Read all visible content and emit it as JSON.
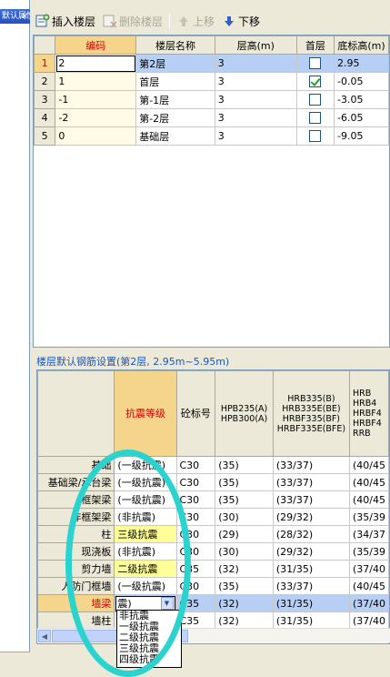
{
  "left_panel": {
    "title": "默认属性",
    "close": "×"
  },
  "toolbar": {
    "insert": "插入楼层",
    "delete": "删除楼层",
    "up": "上移",
    "down": "下移"
  },
  "floor_table": {
    "headers": [
      "编码",
      "楼层名称",
      "层高(m)",
      "首层",
      "底标高(m)"
    ],
    "rows": [
      {
        "n": "1",
        "code": "2",
        "name": "第2层",
        "height": "3",
        "first": false,
        "elev": "2.95"
      },
      {
        "n": "2",
        "code": "1",
        "name": "首层",
        "height": "3",
        "first": true,
        "elev": "-0.05"
      },
      {
        "n": "3",
        "code": "-1",
        "name": "第-1层",
        "height": "3",
        "first": false,
        "elev": "-3.05"
      },
      {
        "n": "4",
        "code": "-2",
        "name": "第-2层",
        "height": "3",
        "first": false,
        "elev": "-6.05"
      },
      {
        "n": "5",
        "code": "0",
        "name": "基础层",
        "height": "3",
        "first": false,
        "elev": "-9.05"
      }
    ]
  },
  "rebar_section": {
    "title": "楼层默认钢筋设置(第2层, 2.95m~5.95m)",
    "headers": {
      "seismic": "抗震等级",
      "concrete": "砼标号",
      "hpb": [
        "HPB235(A)",
        "HPB300(A)"
      ],
      "hrb": [
        "HRB335(B)",
        "HRB335E(BE)",
        "HRBF335(BF)",
        "HRBF335E(BFE)"
      ],
      "hrb4": [
        "HRB",
        "HRB4",
        "HRBF4",
        "HRBF4",
        "RRB"
      ]
    },
    "rows": [
      {
        "name": "基础",
        "seis": "(一级抗震)",
        "conc": "C30",
        "hpb": "(35)",
        "hrb": "(33/37)",
        "r3": "(40/45"
      },
      {
        "name": "基础梁/承台梁",
        "seis": "(一级抗震)",
        "conc": "C30",
        "hpb": "(35)",
        "hrb": "(33/37)",
        "r3": "(40/45"
      },
      {
        "name": "框架梁",
        "seis": "(一级抗震)",
        "conc": "C30",
        "hpb": "(35)",
        "hrb": "(33/37)",
        "r3": "(40/45"
      },
      {
        "name": "非框架梁",
        "seis": "(非抗震)",
        "conc": "C30",
        "hpb": "(30)",
        "hrb": "(29/32)",
        "r3": "(35/39"
      },
      {
        "name": "柱",
        "seis": "三级抗震",
        "conc": "C30",
        "hpb": "(29)",
        "hrb": "(28/32)",
        "r3": "(34/37"
      },
      {
        "name": "现浇板",
        "seis": "(非抗震)",
        "conc": "C30",
        "hpb": "(30)",
        "hrb": "(29/32)",
        "r3": "(35/39"
      },
      {
        "name": "剪力墙",
        "seis": "二级抗震",
        "conc": "C35",
        "hpb": "(32)",
        "hrb": "(31/35)",
        "r3": "(37/40"
      },
      {
        "name": "人防门框墙",
        "seis": "(一级抗震)",
        "conc": "C30",
        "hpb": "(35)",
        "hrb": "(33/37)",
        "r3": "(40/45"
      },
      {
        "name": "墙梁",
        "seis": "震)",
        "conc": "C35",
        "hpb": "(32)",
        "hrb": "(31/35)",
        "r3": "(37/40"
      },
      {
        "name": "墙柱",
        "seis": "",
        "conc": "C35",
        "hpb": "(32)",
        "hrb": "(31/35)",
        "r3": "(37/40"
      }
    ]
  },
  "dropdown_options": [
    "非抗震",
    "一级抗震",
    "二级抗震",
    "三级抗震",
    "四级抗震"
  ],
  "colors": {
    "highlight": "#2bd3cf",
    "selection": "#b7cff4",
    "header_accent": "#f5d58c"
  }
}
